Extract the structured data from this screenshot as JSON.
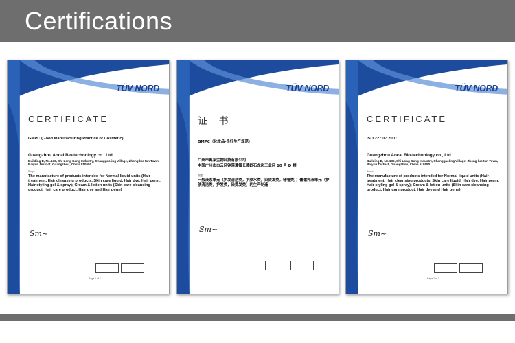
{
  "header": {
    "title": "Certifications"
  },
  "brand": {
    "header_color": "#6e6e6e",
    "logo_color": "#1a3f8f"
  },
  "certs": [
    {
      "logo": "TÜV NORD",
      "title": "CERTIFICATE",
      "standard": "GMPC (Good Manufacturing Practice of Cosmetic)",
      "company": "Guangzhou Aocai Bio-technology co., Ltd.",
      "address": "Building D, No.136, Shi Long Gang Industry, Changgaoling Village, Zhong luo tan Town, Baiyun District, Guangzhou, China 510550",
      "scope_label": "Scope",
      "scope": "The manufacture of products intended for Normal liquid units (Hair treatment, Hair cleansing products, Skin care liquid, Hair dye, Hair perm, Hair styling gel & spray); Cream & lotion units (Skin care cleansing product, Hair care product, Hair dye and Hair perm)",
      "page": "Page 1 of 1"
    },
    {
      "logo": "TÜV NORD",
      "title": "证 书",
      "standard": "GMPC（化妆品-良好生产规范）",
      "company": "广州市奥采生物科技有限公司",
      "address": "中国广州市白云区钟落潭镇长腰岭石龙岗工业区 10 号 D 幢",
      "scope_label": "范围",
      "scope": "一般液态单元（护发清洁类，护肤水类，染烫发类，啫喱类）；膏霜乳液单元（护肤清洁类，护发类，染烫发类）的生产制造",
      "page": ""
    },
    {
      "logo": "TÜV NORD",
      "title": "CERTIFICATE",
      "standard": "ISO 22716: 2007",
      "company": "Guangzhou Aocai Bio-technology co., Ltd.",
      "address": "Building D, No.136, Shi Long Gang Industry, Changgaoling Village, Zhong luo tan Town, Baiyun District, Guangzhou, China 510550",
      "scope_label": "Scope",
      "scope": "The manufacture of products intended for Normal liquid units (Hair treatment, Hair cleansing products, Skin care liquid, Hair dye, Hair perm, Hair styling gel & spray); Cream & lotion units (Skin care cleansing product, Hair care product, Hair dye and Hair perm)",
      "page": "Page 1 of 1"
    }
  ]
}
